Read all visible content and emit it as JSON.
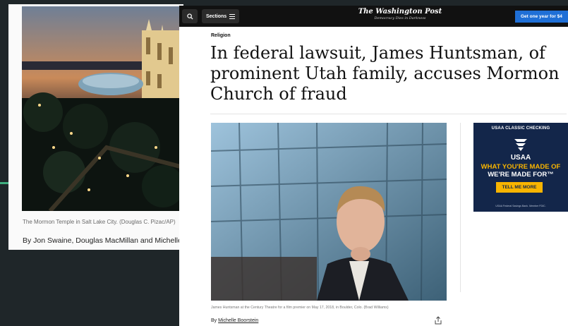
{
  "back_article": {
    "caption": "The Mormon Temple in Salt Lake City. (Douglas C. Pizac/AP)",
    "byline": "By Jon Swaine, Douglas MacMillan and Michelle Boorstein"
  },
  "header": {
    "search_icon": "search-icon",
    "sections_label": "Sections",
    "sections_icon": "hamburger-icon",
    "masthead_name": "The Washington Post",
    "masthead_tagline": "Democracy Dies in Darkness",
    "subscribe_label": "Get one year for $4"
  },
  "article": {
    "kicker": "Religion",
    "headline": "In federal lawsuit, James Huntsman, of prominent Utah family, accuses Mormon Church of fraud",
    "photo_caption": "James Huntsman at the Century Theatre for a film premier on May 17, 2018, in Boulder, Colo. (Brad Williams)",
    "byline_prefix": "By",
    "author": "Michelle Boorstein",
    "share_icon": "share-icon"
  },
  "ad": {
    "top_text": "USAA CLASSIC CHECKING",
    "brand": "USAA",
    "line1": "WHAT YOU'RE MADE OF",
    "line2": "WE'RE MADE FOR™",
    "cta": "TELL ME MORE",
    "fine_print": "USAA Federal Savings Bank. Member FDIC.",
    "colors": {
      "background": "#13264a",
      "accent": "#f8b400"
    }
  }
}
